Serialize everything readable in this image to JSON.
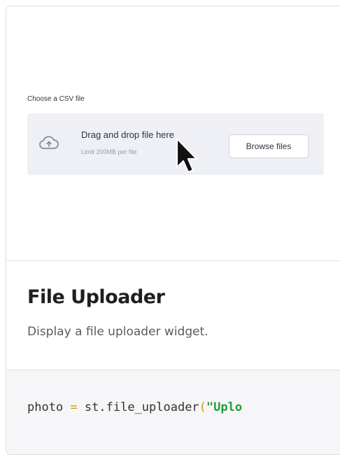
{
  "preview": {
    "widget_label": "Choose a CSV file",
    "dropzone": {
      "title": "Drag and drop file here",
      "subtitle": "Limit 200MB per file",
      "browse_label": "Browse files",
      "icon": "cloud-upload-icon"
    },
    "cursor_icon": "pointer-cursor-icon"
  },
  "description": {
    "title": "File Uploader",
    "text": "Display a file uploader widget."
  },
  "code": {
    "var": "photo",
    "op": " = ",
    "call": "st.file_uploader",
    "paren": "(",
    "arg": "\"Uplo"
  },
  "colors": {
    "dropzone_bg": "#eef0f5",
    "code_bg": "#f6f6f8",
    "string": "#1f9d3a",
    "operator": "#c8a200"
  }
}
